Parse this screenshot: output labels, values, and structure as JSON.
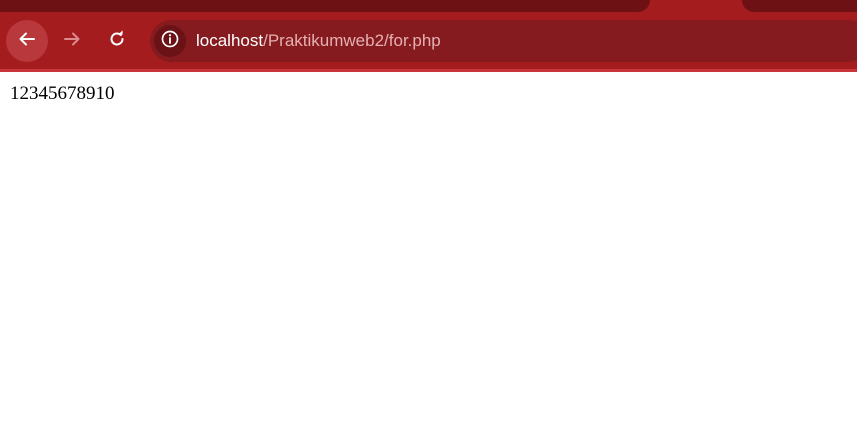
{
  "browser": {
    "address_bar": {
      "host": "localhost",
      "path": "/Praktikumweb2/for.php"
    },
    "icons": {
      "back": "arrow-left-icon",
      "forward": "arrow-right-icon",
      "reload": "reload-icon",
      "site_info": "info-icon"
    },
    "colors": {
      "chrome": "#a51c1f",
      "omnibox": "#861b1f"
    }
  },
  "page": {
    "output": "12345678910"
  }
}
